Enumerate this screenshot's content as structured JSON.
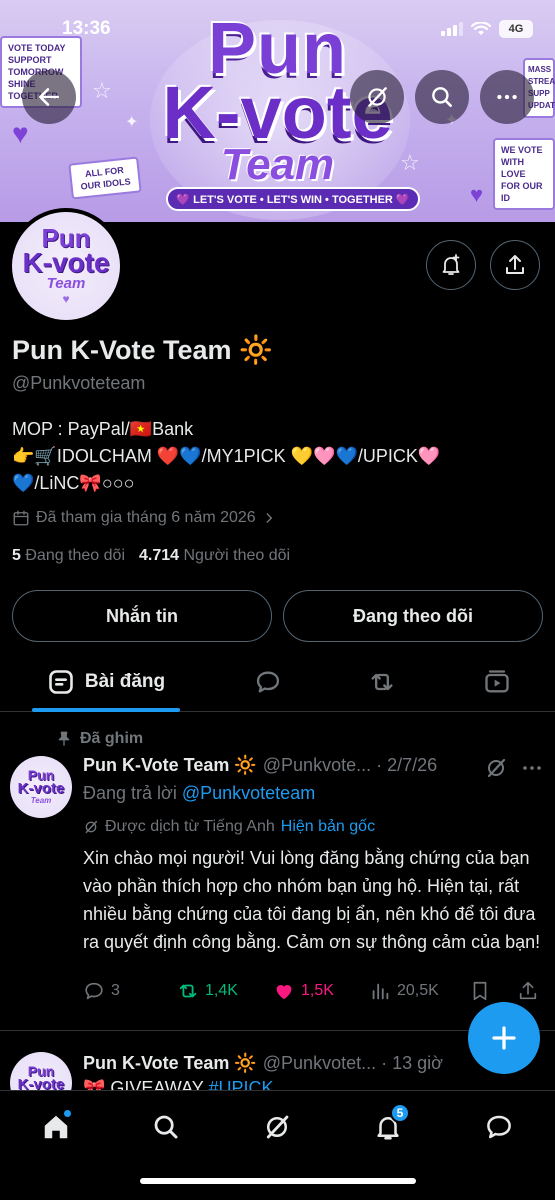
{
  "status_bar": {
    "time": "13:36",
    "network": "4G"
  },
  "banner": {
    "line1": "Pun",
    "line2": "K-vote",
    "line3": "Team",
    "ribbon": "💜 LET'S VOTE • LET'S WIN • TOGETHER 💜",
    "note_left": "VOTE TODAY\nSUPPORT TOMORROW\nSHINE TOGETHER",
    "note_right_top": "MASS\nSTREA\nSUPP\nUPDATE",
    "note_right_bottom": "WE VOTE\nWITH LOVE\nFOR OUR ID",
    "note_ticket": "ALL FOR\nOUR IDOLS"
  },
  "avatar": {
    "line1": "Pun",
    "line2": "K-vote",
    "line3": "Team",
    "heart": "♥"
  },
  "profile": {
    "display_name": "Pun K-Vote Team 🔆",
    "handle": "@Punkvoteteam",
    "bio_line1": "MOP : PayPal/🇻🇳Bank",
    "bio_line2": "👉🛒IDOLCHAM ❤️💙/MY1PICK 💛🩷💙/UPICK🩷",
    "bio_line3": "💙/LiNC🎀○○○",
    "joined": "Đã tham gia tháng 6 năm 2026",
    "following_count": "5",
    "following_label": "Đang theo dõi",
    "followers_count": "4.714",
    "followers_label": "Người theo dõi",
    "message_button": "Nhắn tin",
    "following_button": "Đang theo dõi"
  },
  "tabs": {
    "posts_label": "Bài đăng"
  },
  "pinned_post": {
    "pinned_label": "Đã ghim",
    "name": "Pun K-Vote Team 🔆",
    "meta": "@Punkvote... · 2/7/26",
    "replying_prefix": "Đang trả lời",
    "replying_mention": "@Punkvoteteam",
    "translated_label": "Được dịch từ Tiếng Anh",
    "show_original": "Hiện bản gốc",
    "text": "Xin chào mọi người! Vui lòng đăng bằng chứng của bạn vào phần thích hợp cho nhóm bạn ủng hộ. Hiện tại, rất nhiều bằng chứng của tôi đang bị ẩn, nên khó để tôi đưa ra quyết định công bằng. Cảm ơn sự thông cảm của bạn!",
    "replies": "3",
    "reposts": "1,4K",
    "likes": "1,5K",
    "views": "20,5K"
  },
  "second_post": {
    "name": "Pun K-Vote Team 🔆",
    "meta": "@Punkvotet... · 13 giờ",
    "text_prefix": "🎀 GIVEAWAY",
    "text_tag": "#UPICK"
  },
  "bottom_nav": {
    "notifications_badge": "5"
  },
  "colors": {
    "accent": "#1d9bf0",
    "like": "#f91880",
    "repost": "#00ba7c",
    "banner_purple": "#7a3fd4"
  }
}
